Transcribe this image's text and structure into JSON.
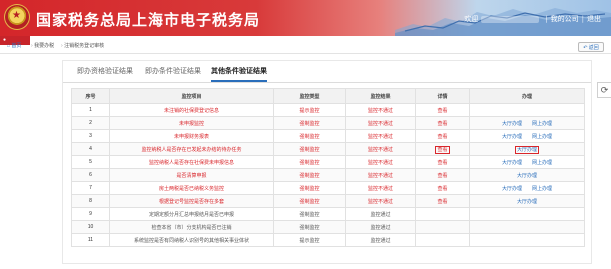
{
  "header": {
    "title": "国家税务总局上海市电子税务局",
    "welcome": "欢迎",
    "my_company": "我的公司",
    "exit": "退出"
  },
  "breadcrumb": {
    "home": "首页",
    "item2": "我要办税",
    "item3": "注销税务登记审核"
  },
  "back_label": "返回",
  "tabs": [
    {
      "label": "即办资格验证结果"
    },
    {
      "label": "即办条件验证结果"
    },
    {
      "label": "其他条件验证结果"
    }
  ],
  "table": {
    "headers": [
      "序号",
      "监控项目",
      "监控类型",
      "监控结果",
      "详情",
      "办理"
    ],
    "rows": [
      {
        "no": "1",
        "item": "未注销的社保费登记信息",
        "type": "提示监控",
        "result": "监控不通过",
        "detail": "查看",
        "op1": "",
        "op2": ""
      },
      {
        "no": "2",
        "item": "未申报监控",
        "type": "强制监控",
        "result": "监控不通过",
        "detail": "查看",
        "op1": "大厅办理",
        "op2": "网上办理"
      },
      {
        "no": "3",
        "item": "未申报财务报表",
        "type": "强制监控",
        "result": "监控不通过",
        "detail": "查看",
        "op1": "大厅办理",
        "op2": "网上办理"
      },
      {
        "no": "4",
        "item": "监控纳税人是否存在已发起未办结的待办任务",
        "type": "强制监控",
        "result": "监控不通过",
        "detail": "查看",
        "op1": "大厅办理",
        "op2": ""
      },
      {
        "no": "5",
        "item": "监控纳税人是否存在社保费未申报信息",
        "type": "强制监控",
        "result": "监控不通过",
        "detail": "查看",
        "op1": "大厅办理",
        "op2": "网上办理"
      },
      {
        "no": "6",
        "item": "是否清算申报",
        "type": "强制监控",
        "result": "监控不通过",
        "detail": "查看",
        "op1": "大厅办理",
        "op2": ""
      },
      {
        "no": "7",
        "item": "房土两税是否已纳税义务监控",
        "type": "强制监控",
        "result": "监控不通过",
        "detail": "查看",
        "op1": "大厅办理",
        "op2": "网上办理"
      },
      {
        "no": "8",
        "item": "根据登记号监控是否存在多套",
        "type": "强制监控",
        "result": "监控不通过",
        "detail": "查看",
        "op1": "大厅办理",
        "op2": ""
      },
      {
        "no": "9",
        "item": "定期定额分月汇总申报结月是否已申报",
        "type": "强制监控",
        "result": "监控通过",
        "detail": "",
        "op1": "",
        "op2": ""
      },
      {
        "no": "10",
        "item": "检查本省（市）分支机构是否已注销",
        "type": "强制监控",
        "result": "监控通过",
        "detail": "",
        "op1": "",
        "op2": ""
      },
      {
        "no": "11",
        "item": "系统监控是否有同纳税人识别号的其他相关事业体状",
        "type": "提示监控",
        "result": "监控通过",
        "detail": "",
        "op1": "",
        "op2": ""
      }
    ]
  },
  "colors": {
    "brand_red": "#d4262a",
    "link_blue": "#2a6ebb",
    "fail_red": "#d9262b"
  },
  "icons": {
    "emblem": "tax-emblem-icon",
    "home": "home-icon",
    "back": "back-arrow-icon",
    "side": "refresh-side-icon"
  }
}
